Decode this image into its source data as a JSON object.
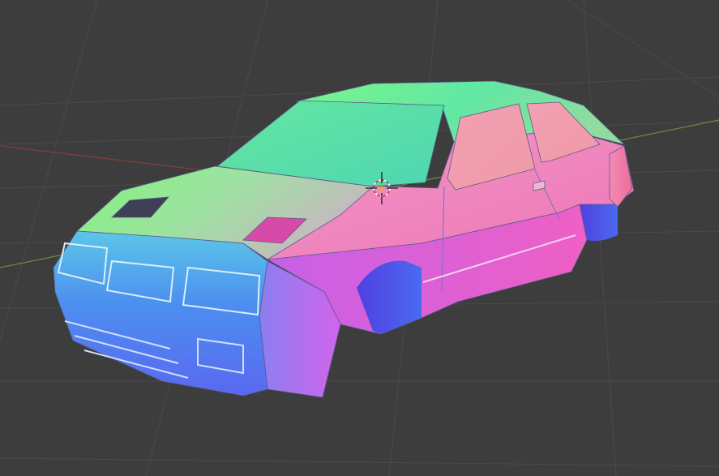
{
  "viewport": {
    "background": "#3d3d3d",
    "grid_color": "#4a4a4a",
    "axis_x_color": "#8a3b3b",
    "axis_y_color": "#6f8a3a",
    "model": "car-body",
    "shading": "normal-map",
    "cursor": "3d-cursor"
  }
}
